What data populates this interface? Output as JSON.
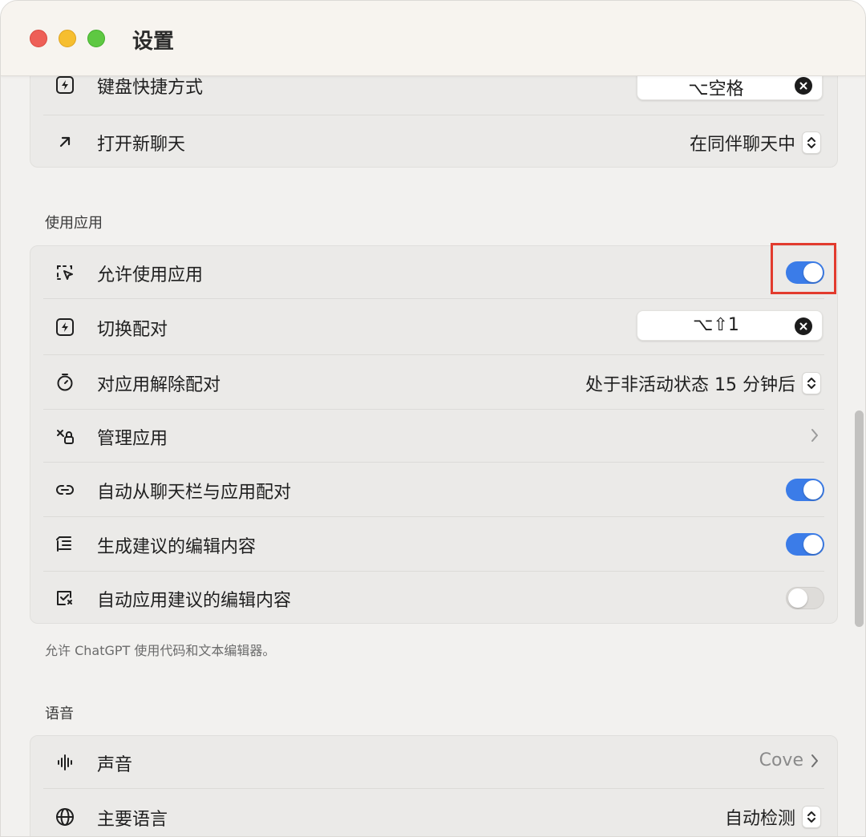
{
  "window": {
    "title": "设置"
  },
  "top_group": {
    "rows": [
      {
        "label": "键盘快捷方式",
        "shortcut": "⌥空格",
        "icon": "bolt-square-icon"
      },
      {
        "label": "打开新聊天",
        "value": "在同伴聊天中",
        "icon": "arrow-up-right-icon"
      }
    ]
  },
  "apps_section": {
    "heading": "使用应用",
    "rows": [
      {
        "label": "允许使用应用",
        "toggle": true,
        "icon": "cursor-select-icon"
      },
      {
        "label": "切换配对",
        "shortcut": "⌥⇧1",
        "icon": "bolt-square-icon"
      },
      {
        "label": "对应用解除配对",
        "value": "处于非活动状态 15 分钟后",
        "icon": "timer-icon"
      },
      {
        "label": "管理应用",
        "icon": "apps-manage-icon"
      },
      {
        "label": "自动从聊天栏与应用配对",
        "toggle": true,
        "icon": "link-icon"
      },
      {
        "label": "生成建议的编辑内容",
        "toggle": true,
        "icon": "suggest-edit-icon"
      },
      {
        "label": "自动应用建议的编辑内容",
        "toggle": false,
        "icon": "auto-apply-icon"
      }
    ],
    "note": "允许 ChatGPT 使用代码和文本编辑器。"
  },
  "voice_section": {
    "heading": "语音",
    "rows": [
      {
        "label": "声音",
        "value": "Cove",
        "icon": "waveform-icon"
      },
      {
        "label": "主要语言",
        "value": "自动检测",
        "icon": "globe-icon"
      }
    ]
  },
  "colors": {
    "toggle_on": "#3b7ce8",
    "highlight": "#e23b2e",
    "close": "#ee5f57",
    "minimize": "#f6be2f",
    "maximize": "#5ec842"
  }
}
